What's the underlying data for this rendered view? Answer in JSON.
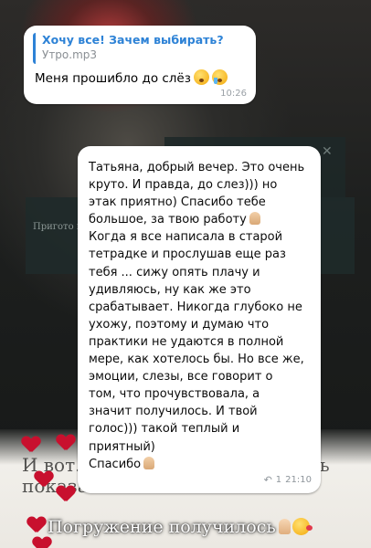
{
  "message_reply": {
    "quote_title": "Хочу все! Зачем выбирать?",
    "quote_subtitle": "Утро.mp3",
    "text": "Меня прошибло до слёз",
    "time": "10:26"
  },
  "message_main": {
    "lines": [
      "Татьяна, добрый вечер. Это очень",
      "круто. И правда, до слез))) но",
      "этак приятно) Спасибо тебе",
      "большое, за твою работу",
      "Когда я все написала в старой",
      "тетрадке и прослушав еще раз",
      "тебя ... сижу опять плачу и",
      "удивляюсь, ну как же это",
      "срабатывает. Никогда глубоко не",
      "ухожу, поэтому и думаю что",
      "практики не удаются в полной",
      "мере, как хотелось бы. Но все же,",
      "эмоции, слезы, все говорит о",
      "том, что прочувствовала, а",
      "значит получилось. И твой",
      "голос))) такой теплый и",
      "приятный)",
      "Спасибо"
    ],
    "reply_count": "1",
    "time": "21:10"
  },
  "background": {
    "card_text": "Пригото кое-что",
    "big_text": "И вот... невозможно захотелось показать вам что-то новое"
  },
  "caption": {
    "text": "Погружение получилось"
  },
  "colors": {
    "accent": "#2d82d6",
    "heart": "#c8102e"
  },
  "icons": [
    "astonished-face-icon",
    "crying-face-icon",
    "folded-hands-icon",
    "reply-arrow-icon",
    "close-icon",
    "heart-icon",
    "smiling-face-hearts-icon"
  ]
}
